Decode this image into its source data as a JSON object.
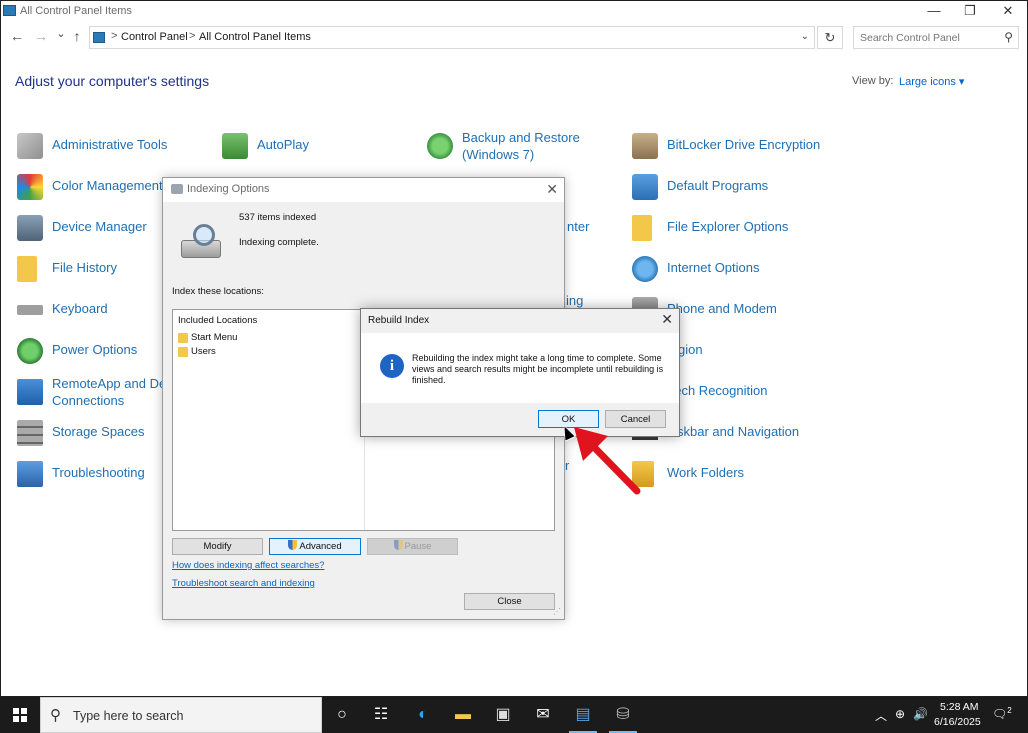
{
  "window": {
    "title": "All Control Panel Items",
    "minimize": "—",
    "restore": "❐",
    "close": "✕"
  },
  "nav": {
    "back": "←",
    "forward": "→",
    "recent": "⌄",
    "up": "↑",
    "refresh": "↻",
    "breadcrumb": [
      "Control Panel",
      "All Control Panel Items"
    ],
    "separator": ">",
    "dropdown": "⌄",
    "search_placeholder": "Search Control Panel",
    "search_icon": "⚲"
  },
  "heading": "Adjust your computer's settings",
  "view_by": {
    "label": "View by:",
    "value": "Large icons ▾"
  },
  "items": {
    "admin_tools": "Administrative Tools",
    "autoplay": "AutoPlay",
    "backup_restore": "Backup and Restore\n(Windows 7)",
    "bitlocker": "BitLocker Drive Encryption",
    "color_management": "Color Management",
    "default_programs": "Default Programs",
    "device_manager": "Device Manager",
    "center_partial": "nter",
    "file_explorer_options": "File Explorer Options",
    "file_history": "File History",
    "internet_options": "Internet Options",
    "keyboard": "Keyboard",
    "indexing_partial": "ing",
    "phone_modem": "Phone and Modem",
    "power_options": "Power Options",
    "region_partial": "gion",
    "remoteapp": "RemoteApp and De\nConnections",
    "speech_partial": "eech Recognition",
    "storage_spaces": "Storage Spaces",
    "taskbar_partial": "skbar and Navigation",
    "troubleshooting": "Troubleshooting",
    "user_partial": "r",
    "work_folders": "Work Folders"
  },
  "indexing_dialog": {
    "title": "Indexing Options",
    "close": "✕",
    "items_indexed": "537 items indexed",
    "status": "Indexing complete.",
    "index_these": "Index these locations:",
    "column_header": "Included Locations",
    "locations": [
      "Start Menu",
      "Users"
    ],
    "modify": "Modify",
    "advanced": "Advanced",
    "pause": "Pause",
    "link1": "How does indexing affect searches?",
    "link2": "Troubleshoot search and indexing",
    "close_button": "Close"
  },
  "rebuild_dialog": {
    "title": "Rebuild Index",
    "close": "✕",
    "info_glyph": "i",
    "message": "Rebuilding the index might take a long time to complete. Some views and search results might be incomplete until rebuilding is finished.",
    "ok": "OK",
    "cancel": "Cancel"
  },
  "taskbar": {
    "search_placeholder": "Type here to search",
    "search_icon": "⚲",
    "cortana_icon": "○",
    "taskview_icon": "☷",
    "edge_icon": "◐",
    "explorer_icon": "▬",
    "store_icon": "▣",
    "mail_icon": "✉",
    "controlpanel_icon": "▤",
    "indexing_icon": "⛁",
    "tray_chevron": "︿",
    "tray_network": "⊕",
    "tray_volume": "🔊",
    "time": "5:28 AM",
    "date": "6/16/2025",
    "notifications": "2"
  },
  "colors": {
    "link_green": "#1e6fb4",
    "heading_blue": "#1e3287",
    "accent": "#0078d7",
    "arrow_red": "#e0141e",
    "taskbar": "#1b1b1b"
  }
}
